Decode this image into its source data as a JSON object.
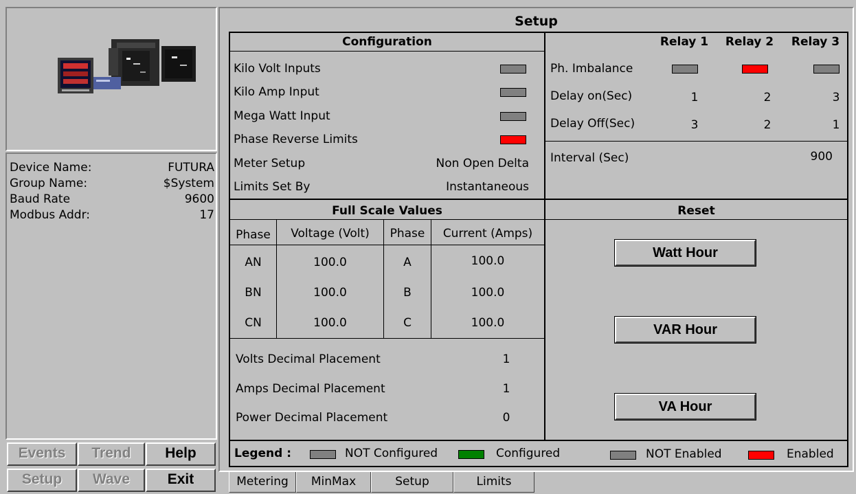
{
  "title": "Setup",
  "device": {
    "rows": [
      {
        "label": "Device Name:",
        "value": "FUTURA"
      },
      {
        "label": "Group Name:",
        "value": "$System"
      },
      {
        "label": "Baud Rate",
        "value": "9600"
      },
      {
        "label": "Modbus Addr:",
        "value": "17"
      }
    ]
  },
  "nav": {
    "events": "Events",
    "trend": "Trend",
    "help": "Help",
    "setup": "Setup",
    "wave": "Wave",
    "exit": "Exit"
  },
  "configuration": {
    "header": "Configuration",
    "kilo_volt": "Kilo Volt Inputs",
    "kilo_amp": "Kilo Amp Input",
    "mega_watt": "Mega Watt Input",
    "phase_reverse": "Phase Reverse Limits",
    "meter_setup_label": "Meter Setup",
    "meter_setup_value": "Non Open Delta",
    "limits_label": "Limits Set By",
    "limits_value": "Instantaneous",
    "states": {
      "kilo_volt": "not_configured",
      "kilo_amp": "not_configured",
      "mega_watt": "not_configured",
      "phase_reverse": "enabled"
    }
  },
  "relays": {
    "headers": [
      "Relay 1",
      "Relay 2",
      "Relay 3"
    ],
    "ph_imbalance_label": "Ph. Imbalance",
    "ph_imbalance_states": [
      "not_enabled",
      "enabled",
      "not_enabled"
    ],
    "delay_on_label": "Delay on(Sec)",
    "delay_on": [
      "1",
      "2",
      "3"
    ],
    "delay_off_label": "Delay Off(Sec)",
    "delay_off": [
      "3",
      "2",
      "1"
    ],
    "interval_label": "Interval (Sec)",
    "interval_value": "900"
  },
  "full_scale": {
    "header": "Full Scale Values",
    "col_phase": "Phase",
    "col_voltage": "Voltage (Volt)",
    "col_phase2": "Phase",
    "col_current": "Current (Amps)",
    "rows": [
      {
        "vphase": "AN",
        "voltage": "100.0",
        "iphase": "A",
        "current": "100.0"
      },
      {
        "vphase": "BN",
        "voltage": "100.0",
        "iphase": "B",
        "current": "100.0"
      },
      {
        "vphase": "CN",
        "voltage": "100.0",
        "iphase": "C",
        "current": "100.0"
      }
    ],
    "volts_dp_label": "Volts Decimal Placement",
    "volts_dp": "1",
    "amps_dp_label": "Amps Decimal Placement",
    "amps_dp": "1",
    "power_dp_label": "Power Decimal Placement",
    "power_dp": "0"
  },
  "reset": {
    "header": "Reset",
    "watt_hour": "Watt Hour",
    "var_hour": "VAR Hour",
    "va_hour": "VA Hour"
  },
  "legend": {
    "label": "Legend :",
    "not_configured": "NOT Configured",
    "configured": "Configured",
    "not_enabled": "NOT Enabled",
    "enabled": "Enabled"
  },
  "tabs": [
    "Metering",
    "MinMax",
    "Setup",
    "Limits"
  ],
  "colors": {
    "not_configured": "#808080",
    "configured": "#008000",
    "enabled": "#ff0000",
    "not_enabled": "#808080",
    "background": "#c0c0c0"
  }
}
